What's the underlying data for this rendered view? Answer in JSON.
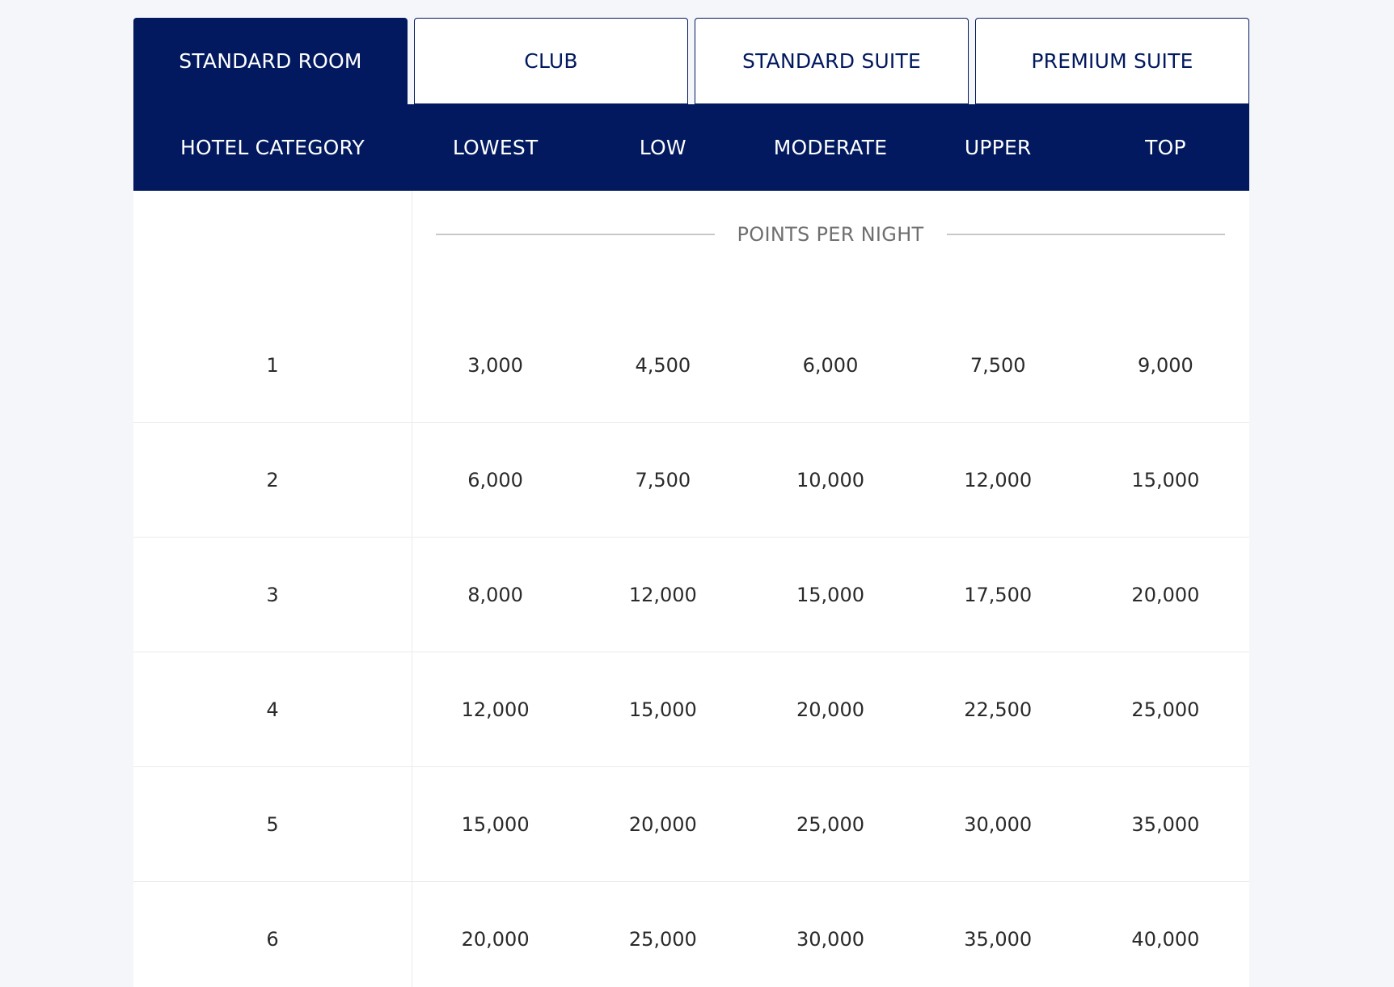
{
  "tabs": [
    {
      "label": "STANDARD ROOM"
    },
    {
      "label": "CLUB"
    },
    {
      "label": "STANDARD SUITE"
    },
    {
      "label": "PREMIUM SUITE"
    }
  ],
  "active_tab": 0,
  "header": {
    "category_label": "HOTEL CATEGORY",
    "columns": [
      "LOWEST",
      "LOW",
      "MODERATE",
      "UPPER",
      "TOP"
    ]
  },
  "points_label": "POINTS PER NIGHT",
  "rows": [
    {
      "category": "1",
      "values": [
        "3,000",
        "4,500",
        "6,000",
        "7,500",
        "9,000"
      ]
    },
    {
      "category": "2",
      "values": [
        "6,000",
        "7,500",
        "10,000",
        "12,000",
        "15,000"
      ]
    },
    {
      "category": "3",
      "values": [
        "8,000",
        "12,000",
        "15,000",
        "17,500",
        "20,000"
      ]
    },
    {
      "category": "4",
      "values": [
        "12,000",
        "15,000",
        "20,000",
        "22,500",
        "25,000"
      ]
    },
    {
      "category": "5",
      "values": [
        "15,000",
        "20,000",
        "25,000",
        "30,000",
        "35,000"
      ]
    },
    {
      "category": "6",
      "values": [
        "20,000",
        "25,000",
        "30,000",
        "35,000",
        "40,000"
      ]
    }
  ],
  "colors": {
    "navy": "#02195f",
    "page_background": "#f5f6fa",
    "divider": "#ececec"
  }
}
